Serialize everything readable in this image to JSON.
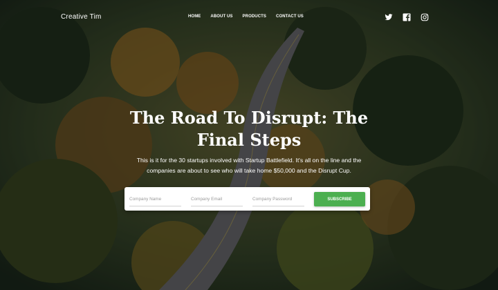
{
  "navbar": {
    "brand": "Creative Tim",
    "links": [
      "HOME",
      "ABOUT US",
      "PRODUCTS",
      "CONTACT US"
    ],
    "social_icons": [
      "twitter-icon",
      "facebook-icon",
      "instagram-icon"
    ]
  },
  "hero": {
    "title": "The Road To Disrupt: The Final Steps",
    "subtitle": "This is it for the 30 startups involved with Startup Battlefield. It's all on the line and the companies are about to see who will take home $50,000 and the Disrupt Cup."
  },
  "form": {
    "company_name_placeholder": "Company Name",
    "company_email_placeholder": "Company Email",
    "company_password_placeholder": "Company Password",
    "subscribe_label": "SUBSCRIBE"
  },
  "colors": {
    "button": "#4caf50"
  }
}
